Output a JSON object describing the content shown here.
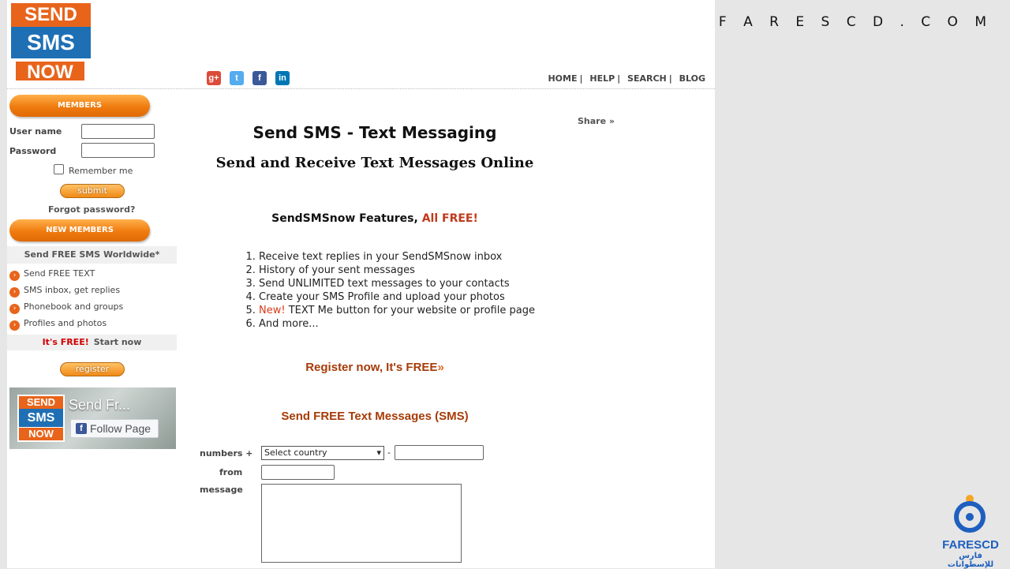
{
  "brand_watermark": "F A R E S C D . C O M",
  "logo": {
    "line1": "SEND",
    "line2": "SMS",
    "line3": "NOW"
  },
  "social": {
    "gplus": "g+",
    "twitter": "t",
    "facebook": "f",
    "linkedin": "in"
  },
  "topnav": {
    "home": "HOME",
    "help": "HELP",
    "search": "SEARCH",
    "blog": "BLOG",
    "sep": "|"
  },
  "sidebar": {
    "members_title": "MEMBERS",
    "username_label": "User name",
    "password_label": "Password",
    "remember_label": "Remember me",
    "submit_label": "submit",
    "forgot_label": "Forgot password?",
    "new_members_title": "NEW MEMBERS",
    "free_worldwide": "Send FREE SMS Worldwide*",
    "features": [
      "Send FREE TEXT",
      "SMS inbox, get replies",
      "Phonebook and groups",
      "Profiles and photos"
    ],
    "its_free": "It's FREE!",
    "start_now": "Start now",
    "register_label": "register"
  },
  "fb_widget": {
    "page_name": "Send Fr...",
    "follow_label": "Follow Page",
    "mini_logo": {
      "line1": "SEND",
      "line2": "SMS",
      "line3": "NOW"
    }
  },
  "main": {
    "share": "Share »",
    "title": "Send SMS - Text Messaging",
    "subtitle": "Send and Receive Text Messages Online",
    "features_title": "SendSMSnow Features,",
    "features_free": "All FREE!",
    "features_list": [
      "Receive text replies in your SendSMSnow inbox",
      "History of your sent messages",
      "Send UNLIMITED text messages to your contacts",
      "Create your SMS Profile and upload your photos",
      "TEXT Me button for your website or profile page",
      "And more..."
    ],
    "new_badge": "New!",
    "register_link": "Register now, It's FREE",
    "register_arrow": "»",
    "sms_form_title": "Send FREE Text Messages (SMS)",
    "numbers_label": "numbers +",
    "country_select": "Select country",
    "dash": "-",
    "from_label": "from",
    "message_label": "message"
  },
  "farescd": {
    "name": "FARESCD",
    "arabic": "فارس للإسطوانات"
  }
}
